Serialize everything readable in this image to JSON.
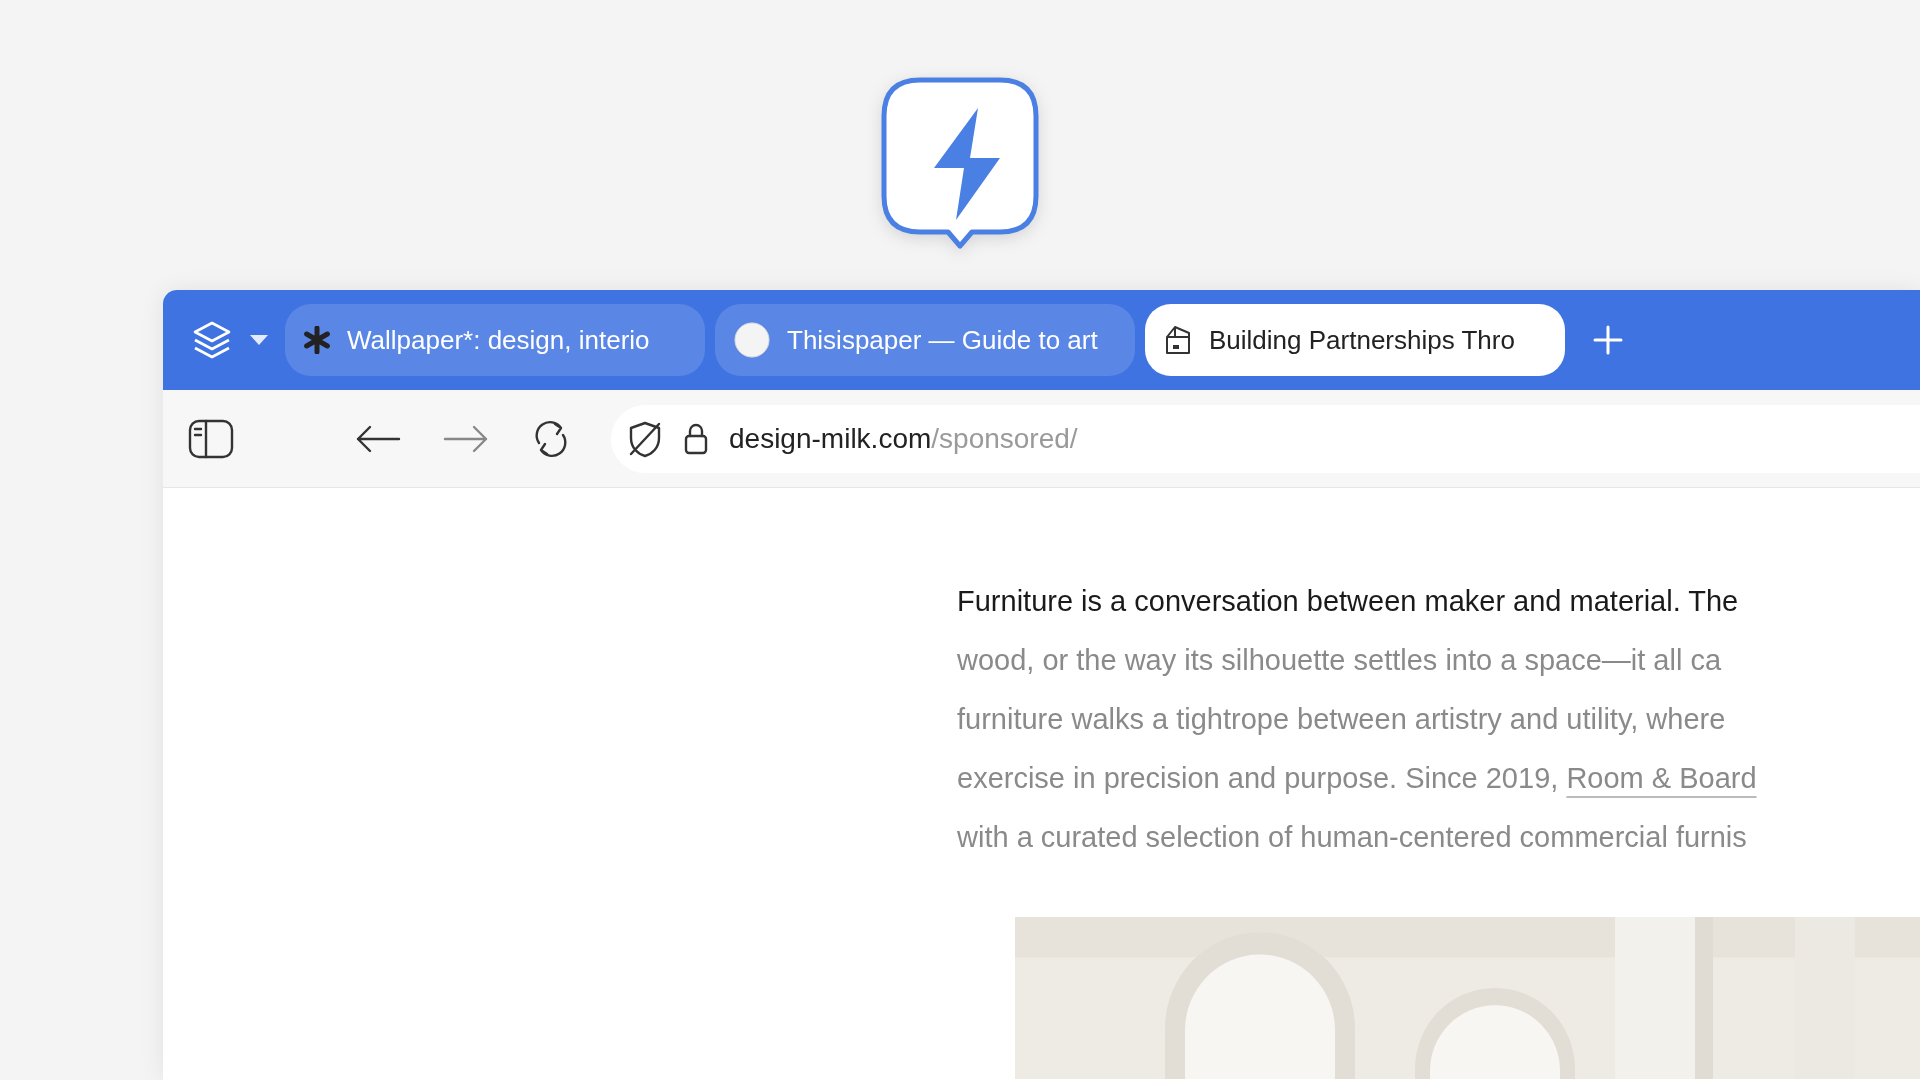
{
  "tabs": [
    {
      "title": "Wallpaper*: design, interio",
      "kind": "asterisk",
      "selected": false
    },
    {
      "title": "Thisispaper — Guide to art",
      "kind": "circle",
      "selected": false
    },
    {
      "title": "Building Partnerships Thro",
      "kind": "building",
      "selected": true
    }
  ],
  "address": {
    "host": "design-milk.com",
    "path": "/sponsored/"
  },
  "article": {
    "lines": [
      {
        "text": "Furniture is a conversation between maker and material. The",
        "highlighted": true
      },
      {
        "text": "wood, or the way its silhouette settles into a space—it all ca",
        "highlighted": false
      },
      {
        "text": "furniture walks a tightrope between artistry and utility, where",
        "highlighted": false
      },
      {
        "text": "exercise in precision and purpose. Since 2019, ",
        "link": "Room & Board",
        "highlighted": false
      },
      {
        "text": "with a curated selection of human-centered commercial furnis",
        "highlighted": false
      }
    ]
  }
}
